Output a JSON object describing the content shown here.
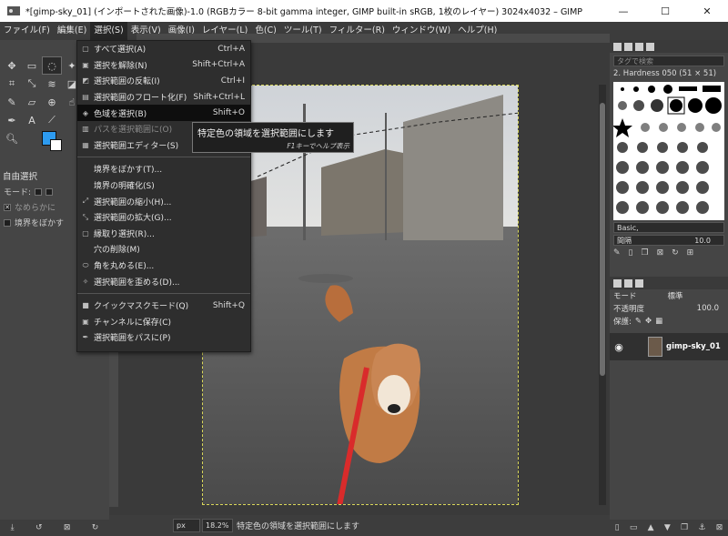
{
  "window": {
    "title": "*[gimp-sky_01] (インポートされた画像)-1.0 (RGBカラー 8-bit gamma integer, GIMP built-in sRGB, 1枚のレイヤー) 3024x4032 – GIMP",
    "minimize": "—",
    "maximize": "☐",
    "close": "✕"
  },
  "menubar": [
    "ファイル(F)",
    "編集(E)",
    "選択(S)",
    "表示(V)",
    "画像(I)",
    "レイヤー(L)",
    "色(C)",
    "ツール(T)",
    "フィルター(R)",
    "ウィンドウ(W)",
    "ヘルプ(H)"
  ],
  "select_menu": {
    "items": [
      {
        "label": "すべて選択(A)",
        "shortcut": "Ctrl+A"
      },
      {
        "label": "選択を解除(N)",
        "shortcut": "Shift+Ctrl+A"
      },
      {
        "label": "選択範囲の反転(I)",
        "shortcut": "Ctrl+I"
      },
      {
        "label": "選択範囲のフロート化(F)",
        "shortcut": "Shift+Ctrl+L"
      },
      {
        "label": "色域を選択(B)",
        "shortcut": "Shift+O"
      },
      {
        "label": "パスを選択範囲に(O)",
        "shortcut": ""
      },
      {
        "label": "選択範囲エディター(S)",
        "shortcut": ""
      },
      {
        "label": "境界をぼかす(T)...",
        "shortcut": ""
      },
      {
        "label": "境界の明確化(S)",
        "shortcut": ""
      },
      {
        "label": "選択範囲の縮小(H)...",
        "shortcut": ""
      },
      {
        "label": "選択範囲の拡大(G)...",
        "shortcut": ""
      },
      {
        "label": "縁取り選択(R)...",
        "shortcut": ""
      },
      {
        "label": "穴の削除(M)",
        "shortcut": ""
      },
      {
        "label": "角を丸める(E)...",
        "shortcut": ""
      },
      {
        "label": "選択範囲を歪める(D)...",
        "shortcut": ""
      },
      {
        "label": "クイックマスクモード(Q)",
        "shortcut": "Shift+Q"
      },
      {
        "label": "チャンネルに保存(C)",
        "shortcut": ""
      },
      {
        "label": "選択範囲をパスに(P)",
        "shortcut": ""
      }
    ]
  },
  "tooltip": {
    "text": "特定色の領域を選択範囲にします",
    "help": "F1キーでヘルプ表示"
  },
  "tool_options": {
    "header": "自由選択",
    "mode_label": "モード:",
    "antialias": "なめらかに",
    "feather": "境界をぼかす"
  },
  "statusbar": {
    "unit": "px",
    "zoom": "18.2%",
    "message": "特定色の領域を選択範囲にします"
  },
  "brushes": {
    "tag_placeholder": "タグで検索",
    "brush_name": "2. Hardness 050 (51 × 51)",
    "preset": "Basic,",
    "spacing_label": "間隔",
    "spacing_value": "10.0"
  },
  "layers": {
    "mode_label": "モード",
    "mode_value": "標準",
    "opacity_label": "不透明度",
    "opacity_value": "100.0",
    "lock_label": "保護:",
    "layer_name": "gimp-sky_01"
  }
}
